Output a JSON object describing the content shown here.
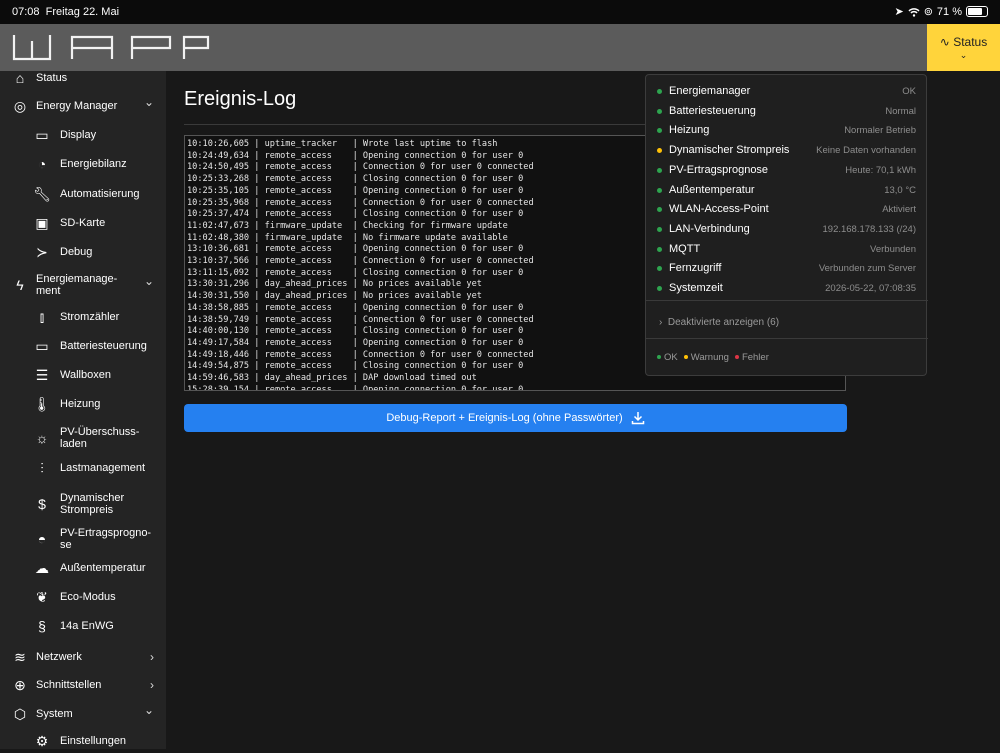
{
  "ios_status": {
    "time": "07:08",
    "date": "Freitag 22. Mai",
    "battery": "71 %",
    "battery_level": 0.71
  },
  "header": {
    "status_label": "Status"
  },
  "sidebar": {
    "items": [
      {
        "label": "Status",
        "icon": "home-icon",
        "level": "top",
        "top": 0
      },
      {
        "label": "Energy Manager",
        "icon": "target-icon",
        "level": "top",
        "chev": "⌄"
      },
      {
        "label": "Display",
        "icon": "monitor-icon",
        "level": "sub"
      },
      {
        "label": "Energiebilanz",
        "icon": "pie-chart-icon",
        "level": "sub"
      },
      {
        "label": "Automatisierung",
        "icon": "wrench-icon",
        "level": "sub"
      },
      {
        "label": "SD-Karte",
        "icon": "floppy-icon",
        "level": "sub"
      },
      {
        "label": "Debug",
        "icon": "terminal-icon",
        "level": "sub"
      },
      {
        "label": "Energiemanage-\nment",
        "icon": "lightning-icon",
        "level": "top",
        "chev": "⌄"
      },
      {
        "label": "Stromzähler",
        "icon": "bar-chart-icon",
        "level": "sub"
      },
      {
        "label": "Batteriesteuerung",
        "icon": "battery-icon",
        "level": "sub"
      },
      {
        "label": "Wallboxen",
        "icon": "server-icon",
        "level": "sub"
      },
      {
        "label": "Heizung",
        "icon": "thermometer-icon",
        "level": "sub"
      },
      {
        "label": "PV-Überschuss-\nladen",
        "icon": "sun-icon",
        "level": "sub"
      },
      {
        "label": "Lastmanagement",
        "icon": "sliders-icon",
        "level": "sub"
      },
      {
        "label": "Dynamischer\nStrompreis",
        "icon": "dollar-circle-icon",
        "level": "sub"
      },
      {
        "label": "PV-Ertragsprogno-\nse",
        "icon": "sunrise-icon",
        "level": "sub"
      },
      {
        "label": "Außentemperatur",
        "icon": "cloud-sun-icon",
        "level": "sub"
      },
      {
        "label": "Eco-Modus",
        "icon": "leaf-icon",
        "level": "sub"
      },
      {
        "label": "14a EnWG",
        "icon": "paragraph-icon",
        "level": "sub"
      },
      {
        "label": "Netzwerk",
        "icon": "wifi-icon",
        "level": "top",
        "chev": "›"
      },
      {
        "label": "Schnittstellen",
        "icon": "globe-icon",
        "level": "top",
        "chev": "›"
      },
      {
        "label": "System",
        "icon": "box-icon",
        "level": "top",
        "chev": "⌄"
      },
      {
        "label": "Einstellungen",
        "icon": "gear-icon",
        "level": "sub"
      }
    ]
  },
  "main": {
    "title": "Ereignis-Log",
    "log_lines": [
      "10:10:26,605 | uptime_tracker   | Wrote last uptime to flash",
      "10:24:49,634 | remote_access    | Opening connection 0 for user 0",
      "10:24:50,495 | remote_access    | Connection 0 for user 0 connected",
      "10:25:33,268 | remote_access    | Closing connection 0 for user 0",
      "10:25:35,105 | remote_access    | Opening connection 0 for user 0",
      "10:25:35,968 | remote_access    | Connection 0 for user 0 connected",
      "10:25:37,474 | remote_access    | Closing connection 0 for user 0",
      "11:02:47,673 | firmware_update  | Checking for firmware update",
      "11:02:48,380 | firmware_update  | No firmware update available",
      "13:10:36,681 | remote_access    | Opening connection 0 for user 0",
      "13:10:37,566 | remote_access    | Connection 0 for user 0 connected",
      "13:11:15,092 | remote_access    | Closing connection 0 for user 0",
      "13:30:31,296 | day_ahead_prices | No prices available yet",
      "14:30:31,550 | day_ahead_prices | No prices available yet",
      "14:38:58,885 | remote_access    | Opening connection 0 for user 0",
      "14:38:59,749 | remote_access    | Connection 0 for user 0 connected",
      "14:40:00,130 | remote_access    | Closing connection 0 for user 0",
      "14:49:17,584 | remote_access    | Opening connection 0 for user 0",
      "14:49:18,446 | remote_access    | Connection 0 for user 0 connected",
      "14:49:54,875 | remote_access    | Closing connection 0 for user 0",
      "14:59:46,583 | day_ahead_prices | DAP download timed out",
      "15:28:39,154 | remote_access    | Opening connection 0 for user 0"
    ],
    "download_label": "Debug-Report + Ereignis-Log  (ohne Passwörter)"
  },
  "status_popup": {
    "items": [
      {
        "name": "Energiemanager",
        "value": "OK",
        "state": "ok"
      },
      {
        "name": "Batteriesteuerung",
        "value": "Normal",
        "state": "ok"
      },
      {
        "name": "Heizung",
        "value": "Normaler Betrieb",
        "state": "ok"
      },
      {
        "name": "Dynamischer Strompreis",
        "value": "Keine Daten vorhanden",
        "state": "warn"
      },
      {
        "name": "PV-Ertragsprognose",
        "value": "Heute: 70,1 kWh",
        "state": "ok"
      },
      {
        "name": "Außentemperatur",
        "value": "13,0 °C",
        "state": "ok"
      },
      {
        "name": "WLAN-Access-Point",
        "value": "Aktiviert",
        "state": "ok"
      },
      {
        "name": "LAN-Verbindung",
        "value": "192.168.178.133 (/24)",
        "state": "ok"
      },
      {
        "name": "MQTT",
        "value": "Verbunden",
        "state": "ok"
      },
      {
        "name": "Fernzugriff",
        "value": "Verbunden zum Server",
        "state": "ok"
      },
      {
        "name": "Systemzeit",
        "value": "2026-05-22, 07:08:35",
        "state": "ok"
      }
    ],
    "show_deactivated": "Deaktivierte anzeigen (6)",
    "legend": {
      "ok": "OK",
      "warn": "Warnung",
      "err": "Fehler"
    }
  },
  "colors": {
    "ok": "#2ea44f",
    "warn": "#ffc107",
    "err": "#dc3545",
    "accent": "#ffd43b",
    "button": "#2580f0"
  }
}
